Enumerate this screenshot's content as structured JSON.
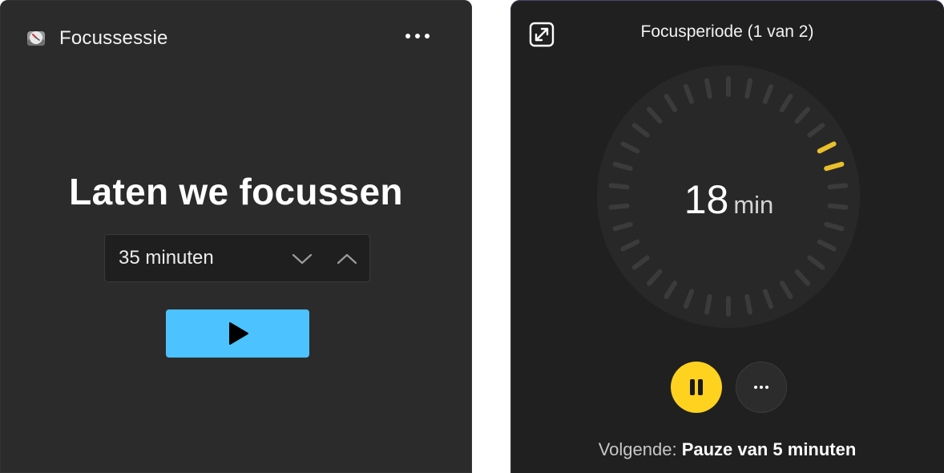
{
  "focus_widget": {
    "app_title": "Focussessie",
    "app_icon": "clock-icon",
    "more_icon": "more-horizontal-icon",
    "headline": "Laten we focussen",
    "duration": {
      "value": "35 minuten",
      "decrease_icon": "chevron-down-icon",
      "increase_icon": "chevron-up-icon"
    },
    "start_icon": "play-icon",
    "accent_color": "#4cc2ff"
  },
  "timer_widget": {
    "expand_icon": "expand-icon",
    "period_title": "Focusperiode (1 van 2)",
    "remaining_value": "18",
    "remaining_unit": "min",
    "progress": {
      "total_ticks": 34,
      "remaining_ticks": 2,
      "elapsed_color": "#3b3b3b",
      "remaining_color": "#e8c02c"
    },
    "pause_icon": "pause-icon",
    "more_icon": "more-horizontal-icon",
    "next_label": "Volgende:",
    "next_value": "Pauze van 5 minuten",
    "accent_color": "#ffd21f"
  }
}
